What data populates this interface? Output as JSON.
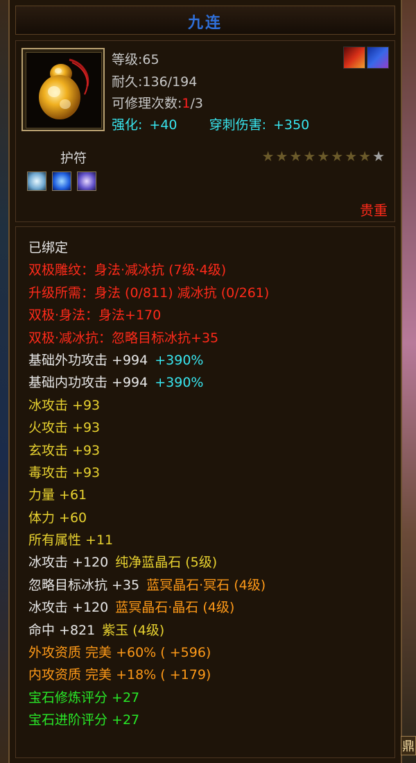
{
  "item": {
    "name": "九连",
    "level_label": "等级:",
    "level": "65",
    "durability_label": "耐久:",
    "durability": "136/194",
    "repair_label": "可修理次数:",
    "repair_used": "1",
    "repair_total": "/3",
    "enhance_label": "强化:",
    "enhance_value": "+40",
    "pierce_label": "穿刺伤害:",
    "pierce_value": "+350",
    "type": "护符",
    "quality": "贵重",
    "stars_lit": 8,
    "stars_total": 9,
    "icon": "amulet-gourd-icon",
    "badges": [
      "fire-badge-icon",
      "water-badge-icon"
    ],
    "gems": [
      "white-gem-icon",
      "blue-gem-icon",
      "purple-gem-icon"
    ]
  },
  "attributes": [
    {
      "parts": [
        {
          "text": "已绑定",
          "color": "white"
        }
      ]
    },
    {
      "parts": [
        {
          "text": "双极雕纹：身法·减冰抗 (7级·4级)",
          "color": "red"
        }
      ]
    },
    {
      "parts": [
        {
          "text": "升级所需：身法 (0/811)  减冰抗 (0/261)",
          "color": "red"
        }
      ]
    },
    {
      "parts": [
        {
          "text": "双极·身法：身法+170",
          "color": "red"
        }
      ]
    },
    {
      "parts": [
        {
          "text": "双极·减冰抗：忽略目标冰抗+35",
          "color": "red"
        }
      ]
    },
    {
      "parts": [
        {
          "text": "基础外功攻击 +994",
          "color": "white"
        },
        {
          "text": "+390%",
          "color": "cyan"
        }
      ]
    },
    {
      "parts": [
        {
          "text": "基础内功攻击 +994",
          "color": "white"
        },
        {
          "text": "+390%",
          "color": "cyan"
        }
      ]
    },
    {
      "parts": [
        {
          "text": "冰攻击 +93",
          "color": "yellow"
        }
      ]
    },
    {
      "parts": [
        {
          "text": "火攻击 +93",
          "color": "yellow"
        }
      ]
    },
    {
      "parts": [
        {
          "text": "玄攻击 +93",
          "color": "yellow"
        }
      ]
    },
    {
      "parts": [
        {
          "text": "毒攻击 +93",
          "color": "yellow"
        }
      ]
    },
    {
      "parts": [
        {
          "text": "力量 +61",
          "color": "yellow"
        }
      ]
    },
    {
      "parts": [
        {
          "text": "体力 +60",
          "color": "yellow"
        }
      ]
    },
    {
      "parts": [
        {
          "text": "所有属性 +11",
          "color": "yellow"
        }
      ]
    },
    {
      "parts": [
        {
          "text": "冰攻击 +120",
          "color": "white"
        },
        {
          "text": "纯净蓝晶石 (5级)",
          "color": "yellow"
        }
      ]
    },
    {
      "parts": [
        {
          "text": "忽略目标冰抗 +35",
          "color": "white"
        },
        {
          "text": "蓝冥晶石·冥石 (4级)",
          "color": "orange"
        }
      ]
    },
    {
      "parts": [
        {
          "text": "冰攻击 +120",
          "color": "white"
        },
        {
          "text": "蓝冥晶石·晶石 (4级)",
          "color": "orange"
        }
      ]
    },
    {
      "parts": [
        {
          "text": "命中 +821",
          "color": "white"
        },
        {
          "text": "紫玉 (4级)",
          "color": "yellow"
        }
      ]
    },
    {
      "parts": [
        {
          "text": "外攻资质  完美 +60% ( +596)",
          "color": "orange"
        }
      ]
    },
    {
      "parts": [
        {
          "text": "内攻资质  完美 +18% ( +179)",
          "color": "orange"
        }
      ]
    },
    {
      "parts": [
        {
          "text": "宝石修炼评分 +27",
          "color": "green"
        }
      ]
    },
    {
      "parts": [
        {
          "text": "宝石进阶评分 +27",
          "color": "green"
        }
      ]
    }
  ],
  "colors": {
    "white": "#e8e8e8",
    "red": "#ff2a1a",
    "yellow": "#e8d230",
    "orange": "#ff9a18",
    "green": "#28e828",
    "cyan": "#38e6f0",
    "title": "#2f6fd8"
  }
}
